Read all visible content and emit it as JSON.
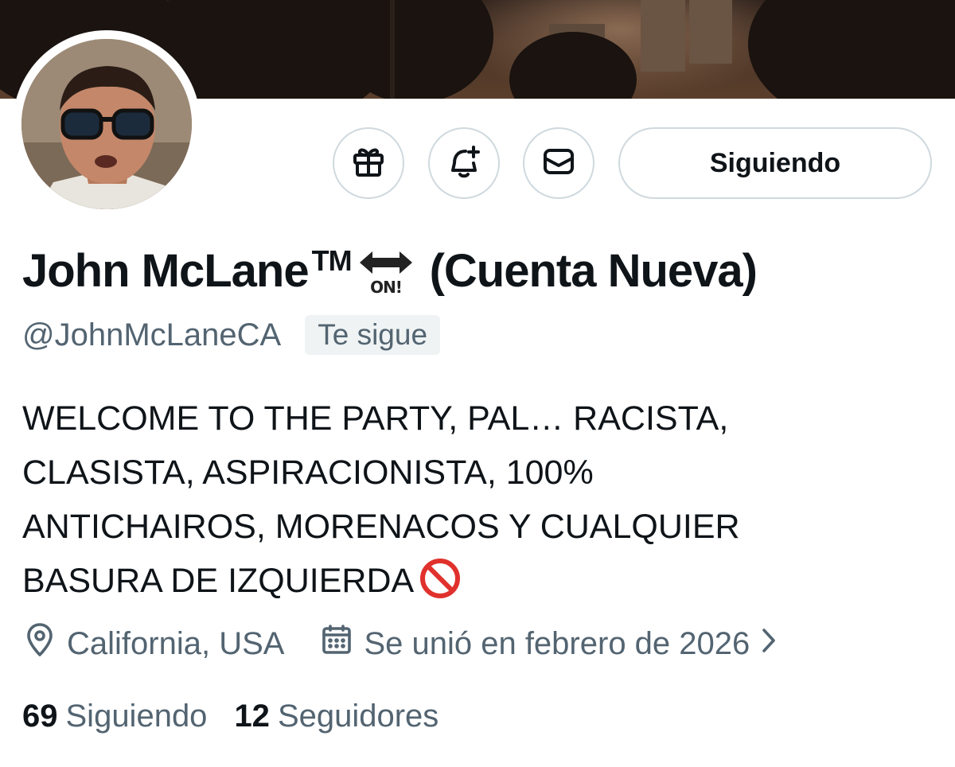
{
  "header": {
    "banner_icon": "banner-image-city-dusk",
    "avatar_icon": "profile-photo"
  },
  "actions": {
    "gift_icon": "gift-icon",
    "notify_icon": "bell-plus-icon",
    "message_icon": "envelope-icon",
    "follow_label": "Siguiendo"
  },
  "profile": {
    "name": "John McLane",
    "tm": "TM",
    "emoji_name": "on-arrow-emoji",
    "emoji_text": "ON!",
    "name_suffix": "(Cuenta Nueva)",
    "handle": "@JohnMcLaneCA",
    "follows_you": "Te sigue",
    "bio_lines": [
      "WELCOME TO THE PARTY, PAL… RACISTA,",
      "CLASISTA, ASPIRACIONISTA, 100%",
      "ANTICHAIROS, MORENACOS Y CUALQUIER",
      "BASURA DE IZQUIERDA"
    ],
    "bio_emoji": "prohibited-emoji",
    "location": "California, USA",
    "joined": "Se unió en febrero de 2026",
    "following_count": "69",
    "following_label": "Siguiendo",
    "followers_count": "12",
    "followers_label": "Seguidores"
  },
  "colors": {
    "text_primary": "#0f1419",
    "text_secondary": "#536471",
    "border": "#cfd9de",
    "badge_bg": "#eff3f4"
  }
}
